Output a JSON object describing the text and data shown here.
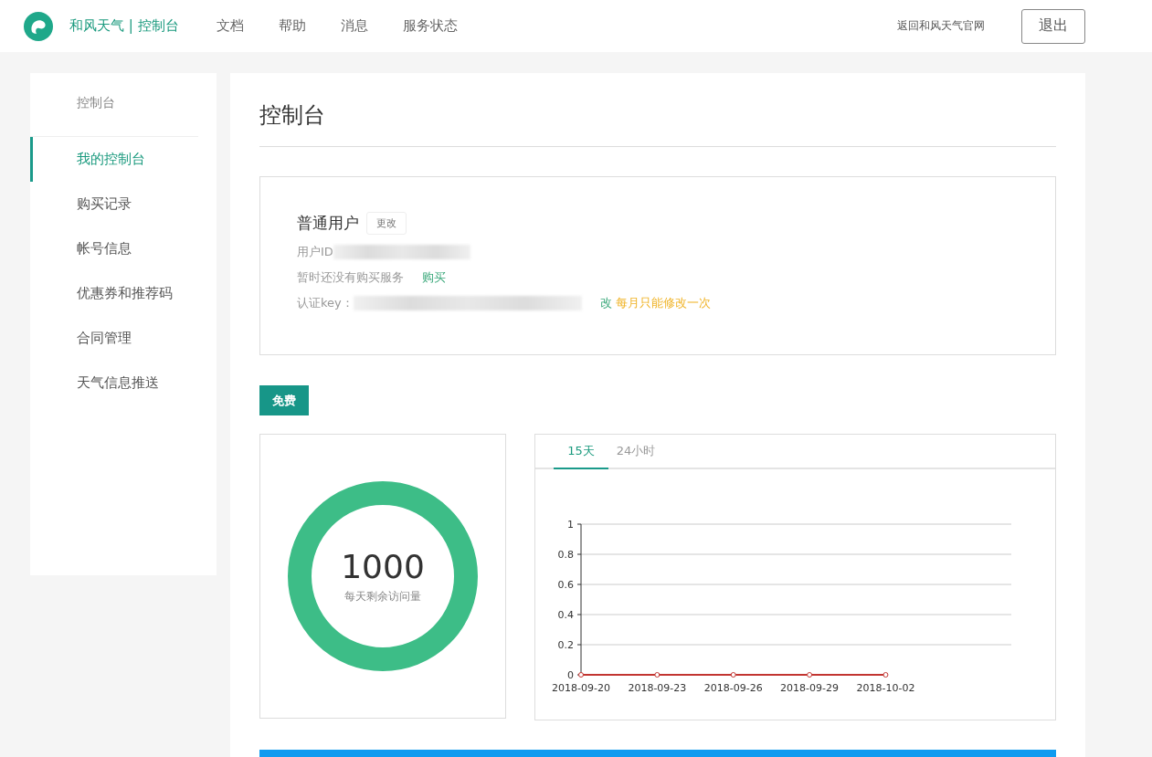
{
  "header": {
    "brand": "和风天气 | 控制台",
    "nav": [
      "文档",
      "帮助",
      "消息",
      "服务状态"
    ],
    "home_link": "返回和风天气官网",
    "logout": "退出"
  },
  "sidebar": {
    "title": "控制台",
    "items": [
      {
        "label": "我的控制台",
        "selected": true
      },
      {
        "label": "购买记录",
        "selected": false
      },
      {
        "label": "帐号信息",
        "selected": false
      },
      {
        "label": "优惠券和推荐码",
        "selected": false
      },
      {
        "label": "合同管理",
        "selected": false
      },
      {
        "label": "天气信息推送",
        "selected": false
      }
    ]
  },
  "page_title": "控制台",
  "account": {
    "level": "普通用户",
    "change": "更改",
    "user_id_label": "用户ID",
    "no_service": "暂时还没有购买服务",
    "buy": "购买",
    "key_label": "认证key：",
    "key_change": "改",
    "key_note": "每月只能修改一次"
  },
  "plan": "免费",
  "quota": {
    "value": "1000",
    "label": "每天剩余访问量"
  },
  "usage": {
    "tabs": [
      {
        "label": "15天",
        "selected": true
      },
      {
        "label": "24小时",
        "selected": false
      }
    ],
    "chart_data": {
      "type": "line",
      "categories": [
        "2018-09-20",
        "2018-09-23",
        "2018-09-26",
        "2018-09-29",
        "2018-10-02"
      ],
      "series": [
        {
          "color": "#c23531",
          "marker": true,
          "values": [
            0,
            0,
            0,
            0,
            0
          ]
        }
      ],
      "grid": true,
      "ylim": [
        0,
        1
      ],
      "yticks": [
        0,
        0.2,
        0.4,
        0.6,
        0.8,
        1
      ]
    }
  }
}
